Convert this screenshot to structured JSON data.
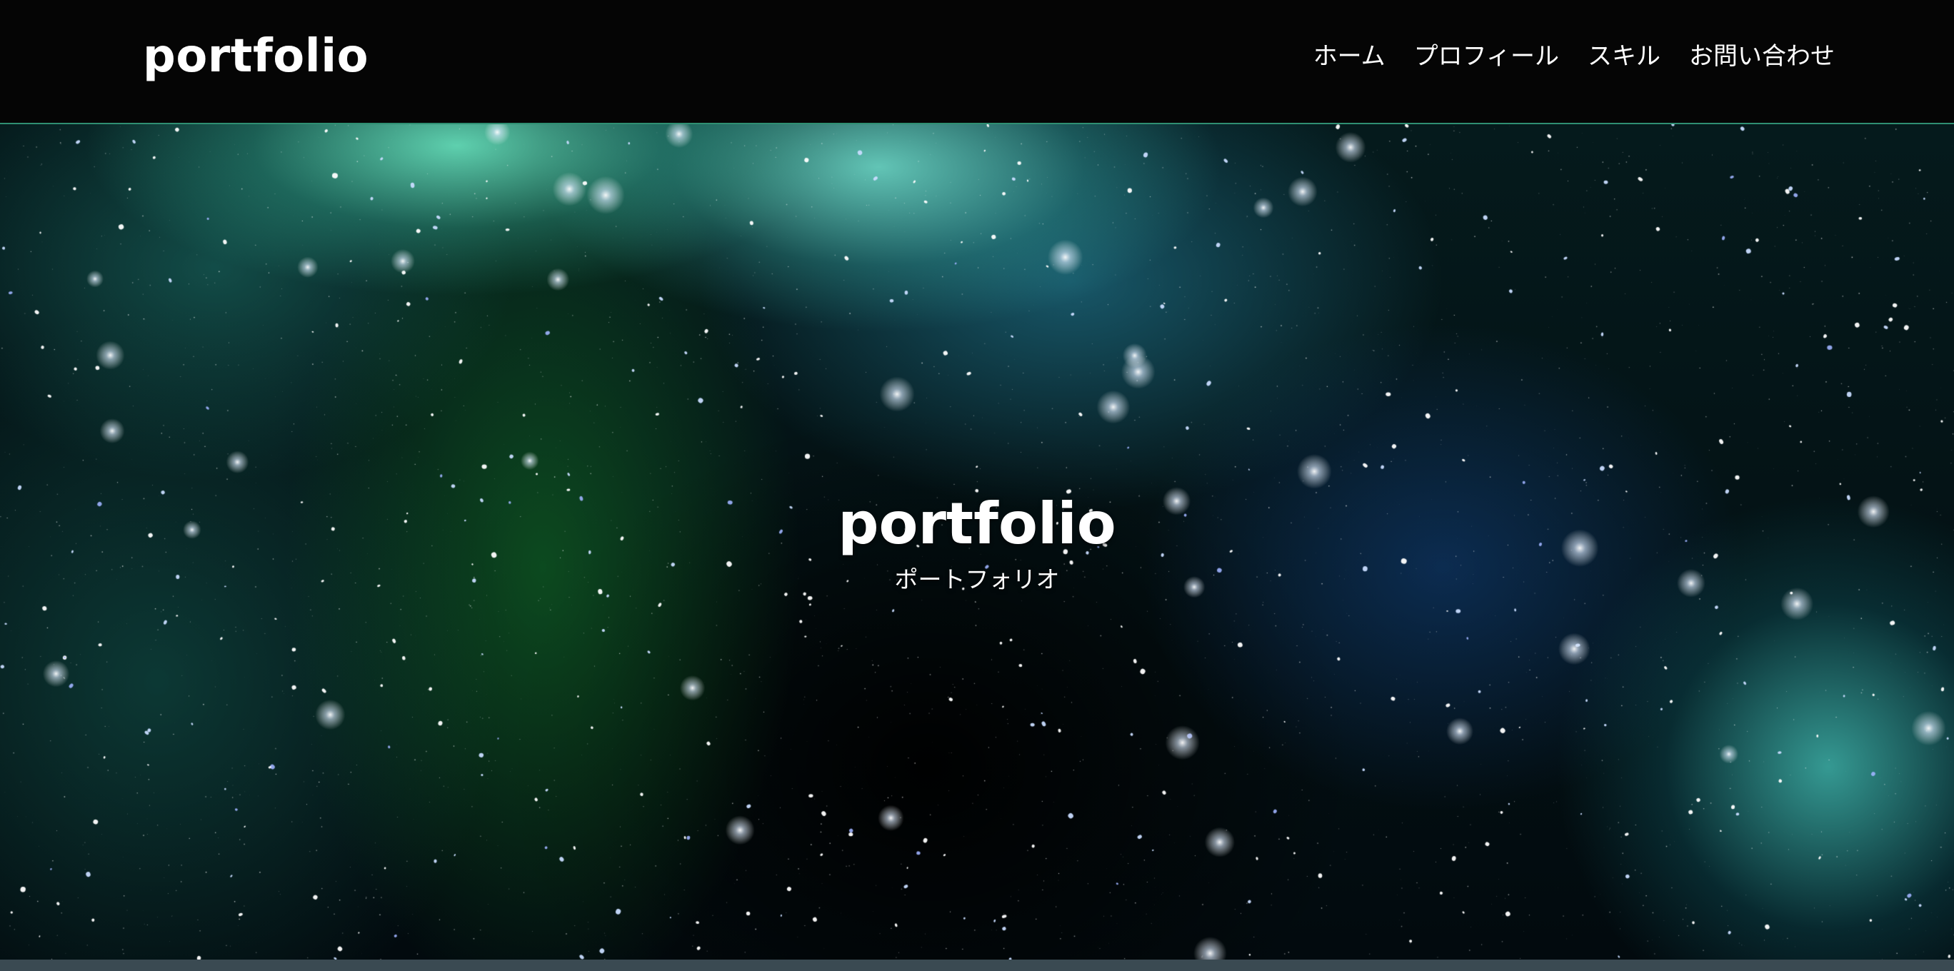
{
  "header": {
    "logo": "portfolio",
    "nav": [
      {
        "label": "ホーム"
      },
      {
        "label": "プロフィール"
      },
      {
        "label": "スキル"
      },
      {
        "label": "お問い合わせ"
      }
    ]
  },
  "hero": {
    "title": "portfolio",
    "subtitle": "ポートフォリオ"
  },
  "colors": {
    "header_bg": "#050505",
    "header_border": "#2f8f72",
    "text": "#ffffff",
    "bottom_strip": "#3a4a52"
  }
}
